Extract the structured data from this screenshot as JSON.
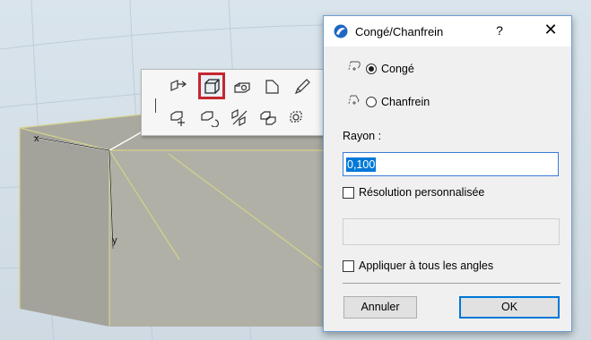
{
  "viewport": {
    "axis_x_label": "x",
    "axis_y_label": "y"
  },
  "toolbar": {
    "row1": [
      "extrude-tool-icon",
      "fillet-chamfer-tool-icon",
      "offset-tool-icon",
      "face-tool-icon",
      "pencil-icon"
    ],
    "row2": [
      "move-element-icon",
      "rotate-element-icon",
      "split-element-icon",
      "duplicate-element-icon",
      "crop-element-icon"
    ],
    "selected_tool": "fillet-chamfer-tool-icon",
    "highlight_color": "#c62630"
  },
  "dialog": {
    "title": "Congé/Chanfrein",
    "help_label": "?",
    "close_label": "✕",
    "options": [
      {
        "label": "Congé",
        "checked": true
      },
      {
        "label": "Chanfrein",
        "checked": false
      }
    ],
    "radius_label": "Rayon :",
    "radius_value": "0,100",
    "custom_resolution_label": "Résolution personnalisée",
    "custom_resolution_checked": false,
    "resolution_value": "",
    "apply_all_label": "Appliquer à tous les angles",
    "apply_all_checked": false,
    "cancel_label": "Annuler",
    "ok_label": "OK",
    "accent_color": "#0078d7"
  }
}
